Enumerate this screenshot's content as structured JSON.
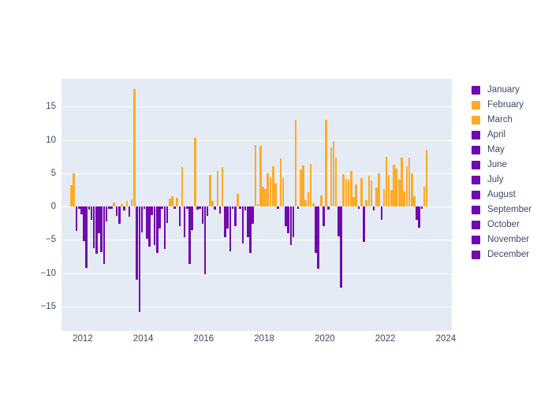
{
  "chart_data": {
    "type": "bar",
    "title": "",
    "subtitle": "",
    "xlabel": "",
    "ylabel": "",
    "xlim": [
      2011.3,
      2024.2
    ],
    "ylim": [
      -18.7,
      19.2
    ],
    "ytick_labels": [
      "15",
      "10",
      "5",
      "0",
      "−5",
      "−10",
      "−15"
    ],
    "ytick_values": [
      15,
      10,
      5,
      0,
      -5,
      -10,
      -15
    ],
    "xtick_labels": [
      "2012",
      "2014",
      "2016",
      "2018",
      "2020",
      "2022",
      "2024"
    ],
    "xtick_values": [
      2012,
      2014,
      2016,
      2018,
      2020,
      2022,
      2024
    ],
    "grid": true,
    "legend_position": "right",
    "plot_background": "#e5ebf5",
    "paper_background": "#ffffff",
    "positive_color": "#feab27",
    "negative_color": "#7208ae",
    "bar_width_years": 0.055,
    "series": [
      {
        "name": "January",
        "color": "#7208ae"
      },
      {
        "name": "February",
        "color": "#feab27"
      },
      {
        "name": "March",
        "color": "#feab27"
      },
      {
        "name": "April",
        "color": "#7208ae"
      },
      {
        "name": "May",
        "color": "#7208ae"
      },
      {
        "name": "June",
        "color": "#7208ae"
      },
      {
        "name": "July",
        "color": "#7208ae"
      },
      {
        "name": "August",
        "color": "#7208ae"
      },
      {
        "name": "September",
        "color": "#7208ae"
      },
      {
        "name": "October",
        "color": "#7208ae"
      },
      {
        "name": "November",
        "color": "#7208ae"
      },
      {
        "name": "December",
        "color": "#7208ae"
      }
    ],
    "x": [
      2011.62,
      2011.71,
      2011.79,
      2011.88,
      2011.96,
      2012.04,
      2012.12,
      2012.21,
      2012.29,
      2012.37,
      2012.46,
      2012.54,
      2012.62,
      2012.71,
      2012.79,
      2012.88,
      2012.96,
      2013.04,
      2013.12,
      2013.21,
      2013.29,
      2013.37,
      2013.46,
      2013.54,
      2013.62,
      2013.71,
      2013.79,
      2013.88,
      2013.96,
      2014.04,
      2014.12,
      2014.21,
      2014.29,
      2014.37,
      2014.46,
      2014.54,
      2014.62,
      2014.71,
      2014.79,
      2014.88,
      2014.96,
      2015.04,
      2015.12,
      2015.21,
      2015.29,
      2015.37,
      2015.46,
      2015.54,
      2015.62,
      2015.71,
      2015.79,
      2015.88,
      2015.96,
      2016.04,
      2016.12,
      2016.21,
      2016.29,
      2016.37,
      2016.46,
      2016.54,
      2016.62,
      2016.71,
      2016.79,
      2016.88,
      2016.96,
      2017.04,
      2017.12,
      2017.21,
      2017.29,
      2017.37,
      2017.46,
      2017.54,
      2017.62,
      2017.71,
      2017.79,
      2017.88,
      2017.96,
      2018.04,
      2018.12,
      2018.21,
      2018.29,
      2018.37,
      2018.46,
      2018.54,
      2018.62,
      2018.71,
      2018.79,
      2018.88,
      2018.96,
      2019.04,
      2019.12,
      2019.21,
      2019.29,
      2019.37,
      2019.46,
      2019.54,
      2019.62,
      2019.71,
      2019.79,
      2019.88,
      2019.96,
      2020.04,
      2020.12,
      2020.21,
      2020.29,
      2020.37,
      2020.46,
      2020.54,
      2020.62,
      2020.71,
      2020.79,
      2020.88,
      2020.96,
      2021.04,
      2021.12,
      2021.21,
      2021.29,
      2021.37,
      2021.46,
      2021.54,
      2021.62,
      2021.71,
      2021.79,
      2021.88,
      2021.96,
      2022.04,
      2022.12,
      2022.21,
      2022.29,
      2022.37,
      2022.46,
      2022.54,
      2022.62,
      2022.71,
      2022.79,
      2022.88,
      2022.96,
      2023.04,
      2023.12,
      2023.21,
      2023.29,
      2023.37
    ],
    "values": [
      3.2,
      5.0,
      -3.6,
      -0.4,
      -1.2,
      -5.2,
      -9.2,
      -0.5,
      -2.0,
      -6.3,
      -7.1,
      -4.0,
      -6.8,
      -8.6,
      -2.2,
      -0.3,
      -0.4,
      0.6,
      -1.4,
      -2.6,
      0.4,
      -0.6,
      0.8,
      -1.5,
      1.1,
      17.7,
      -11.0,
      -15.8,
      -3.9,
      -0.3,
      -4.8,
      -6.0,
      -1.3,
      -5.8,
      -7.0,
      -3.3,
      -0.4,
      -6.4,
      -2.5,
      1.2,
      1.6,
      -0.4,
      1.3,
      -3.0,
      5.9,
      -4.6,
      -0.3,
      -8.6,
      -3.5,
      10.3,
      -0.5,
      -0.3,
      -2.6,
      -10.2,
      -1.4,
      4.8,
      0.9,
      -0.5,
      5.4,
      -1.0,
      5.9,
      -4.6,
      -3.3,
      -6.7,
      -0.4,
      -3.0,
      1.9,
      -0.4,
      -5.5,
      -0.6,
      -4.6,
      -7.0,
      -2.6,
      9.3,
      0.4,
      9.1,
      3.0,
      2.6,
      5.0,
      4.4,
      6.1,
      3.4,
      -0.3,
      7.2,
      4.3,
      -3.0,
      -4.0,
      -5.8,
      -4.6,
      13.0,
      -0.3,
      5.6,
      6.2,
      1.0,
      2.2,
      6.4,
      0.5,
      -7.0,
      -9.4,
      1.7,
      -3.0,
      13.1,
      -0.5,
      8.9,
      9.9,
      7.3,
      -4.5,
      -12.2,
      4.9,
      4.2,
      4.0,
      5.3,
      1.4,
      3.3,
      -0.4,
      4.3,
      -5.3,
      1.0,
      4.6,
      3.9,
      -0.6,
      2.8,
      5.0,
      -2.0,
      2.6,
      7.5,
      4.8,
      2.5,
      6.3,
      5.7,
      4.0,
      7.3,
      2.3,
      6.0,
      7.4,
      5.0,
      1.6,
      -2.0,
      -3.2,
      -0.4,
      3.0,
      8.5
    ]
  },
  "legend": {
    "items": [
      {
        "label": "January",
        "color": "#7208ae"
      },
      {
        "label": "February",
        "color": "#feab27"
      },
      {
        "label": "March",
        "color": "#feab27"
      },
      {
        "label": "April",
        "color": "#7208ae"
      },
      {
        "label": "May",
        "color": "#7208ae"
      },
      {
        "label": "June",
        "color": "#7208ae"
      },
      {
        "label": "July",
        "color": "#7208ae"
      },
      {
        "label": "August",
        "color": "#7208ae"
      },
      {
        "label": "September",
        "color": "#7208ae"
      },
      {
        "label": "October",
        "color": "#7208ae"
      },
      {
        "label": "November",
        "color": "#7208ae"
      },
      {
        "label": "December",
        "color": "#7208ae"
      }
    ]
  }
}
